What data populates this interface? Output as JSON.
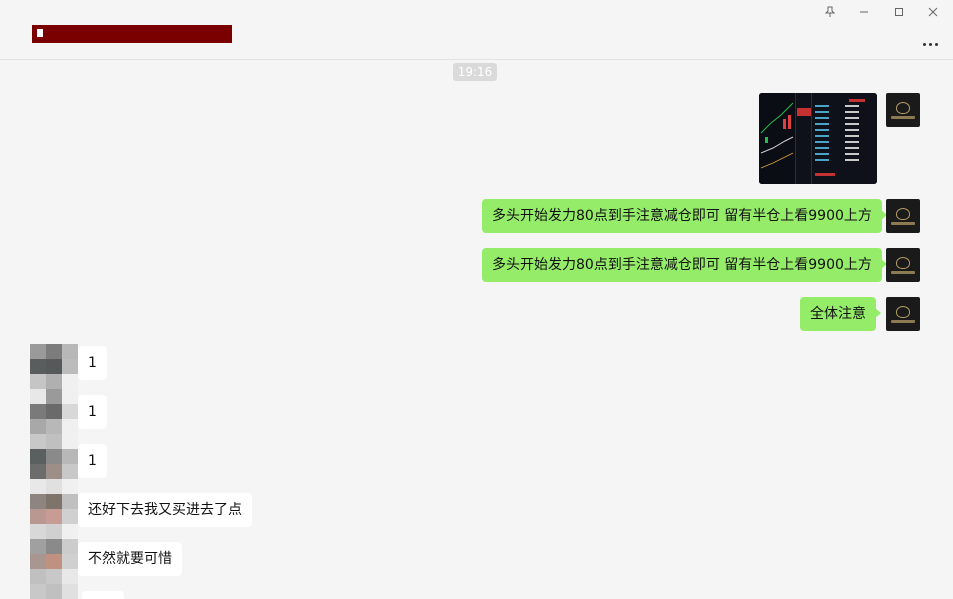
{
  "window": {
    "pin_icon": "pin-icon",
    "minimize_icon": "minimize-icon",
    "maximize_icon": "maximize-icon",
    "close_icon": "close-icon",
    "more_icon": "more-icon"
  },
  "chat": {
    "title_redacted": true,
    "time_divider": "19:16"
  },
  "colors": {
    "my_bubble": "#95ec69",
    "other_bubble": "#ffffff",
    "background": "#f5f5f5",
    "title_redaction": "#7a0000"
  },
  "messages_sent": [
    {
      "type": "image",
      "description_icon": "chart-screenshot-image"
    },
    {
      "type": "text",
      "text": "多头开始发力80点到手注意减仓即可 留有半仓上看9900上方"
    },
    {
      "type": "text",
      "text": "多头开始发力80点到手注意减仓即可 留有半仓上看9900上方"
    },
    {
      "type": "text",
      "text": "全体注意"
    }
  ],
  "messages_received": [
    {
      "text": "1"
    },
    {
      "text": "1"
    },
    {
      "text": "1"
    },
    {
      "text": "还好下去我又买进去了点"
    },
    {
      "text": "不然就要可惜"
    }
  ]
}
